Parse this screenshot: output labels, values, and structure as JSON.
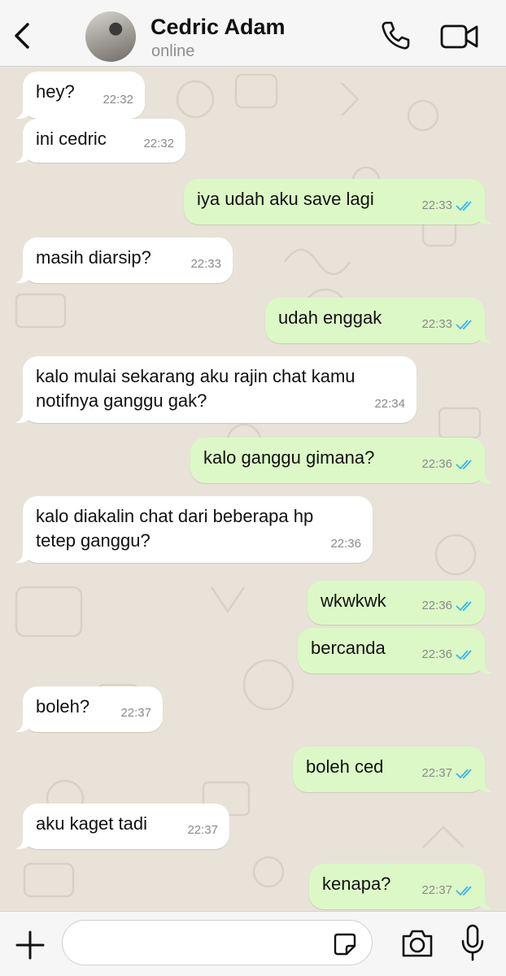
{
  "header": {
    "contact_name": "Cedric Adam",
    "status": "online"
  },
  "icons": {
    "back": "chevron-left-icon",
    "call": "phone-icon",
    "video": "video-camera-icon",
    "add": "plus-icon",
    "sticker": "sticker-icon",
    "camera": "camera-icon",
    "mic": "microphone-icon",
    "read_receipt": "double-check-icon"
  },
  "colors": {
    "incoming_bubble": "#ffffff",
    "outgoing_bubble": "#dcf8c6",
    "read_ticks": "#34b7f1",
    "chat_background": "#e9e2d8"
  },
  "messages": [
    {
      "direction": "in",
      "text": "hey?",
      "time": "22:32"
    },
    {
      "direction": "in",
      "text": "ini cedric",
      "time": "22:32"
    },
    {
      "direction": "out",
      "text": "iya udah aku save lagi",
      "time": "22:33",
      "read": true
    },
    {
      "direction": "in",
      "text": "masih diarsip?",
      "time": "22:33"
    },
    {
      "direction": "out",
      "text": "udah enggak",
      "time": "22:33",
      "read": true
    },
    {
      "direction": "in",
      "text": "kalo mulai sekarang aku rajin chat kamu\nnotifnya ganggu gak?",
      "time": "22:34"
    },
    {
      "direction": "out",
      "text": "kalo ganggu gimana?",
      "time": "22:36",
      "read": true
    },
    {
      "direction": "in",
      "text": "kalo diakalin chat dari beberapa hp\ntetep ganggu?",
      "time": "22:36"
    },
    {
      "direction": "out",
      "text": "wkwkwk",
      "time": "22:36",
      "read": true
    },
    {
      "direction": "out",
      "text": "bercanda",
      "time": "22:36",
      "read": true
    },
    {
      "direction": "in",
      "text": "boleh?",
      "time": "22:37"
    },
    {
      "direction": "out",
      "text": "boleh ced",
      "time": "22:37",
      "read": true
    },
    {
      "direction": "in",
      "text": "aku kaget tadi",
      "time": "22:37"
    },
    {
      "direction": "out",
      "text": "kenapa?",
      "time": "22:37",
      "read": true
    }
  ],
  "composer": {
    "value": ""
  }
}
